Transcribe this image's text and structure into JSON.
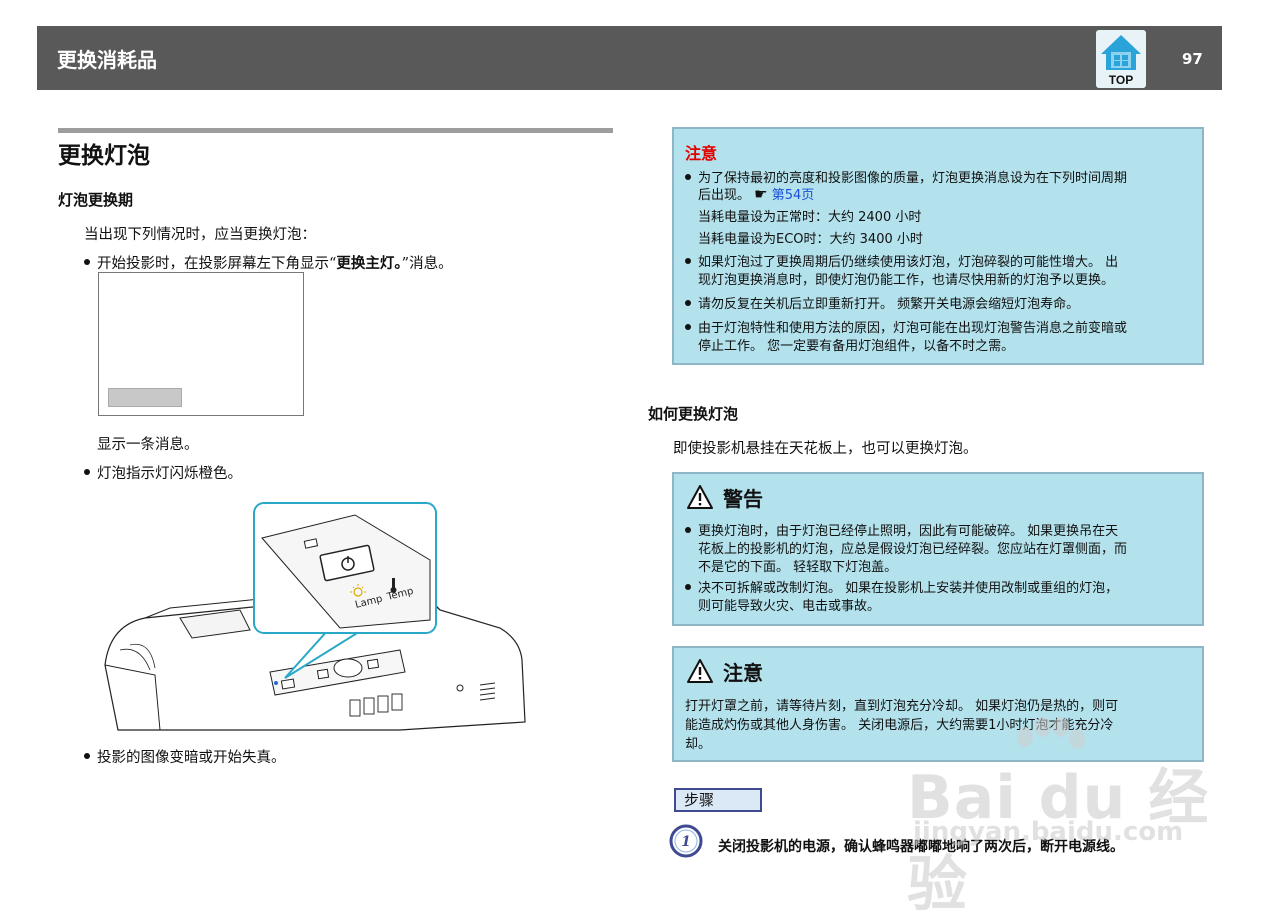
{
  "header": {
    "title": "更换消耗品",
    "top_label": "TOP",
    "page_number": "97",
    "top_icon": "top-house-icon",
    "colors": {
      "bar": "#595959",
      "top_icon": "#2aa4d8"
    }
  },
  "left": {
    "section_title": "更换灯泡",
    "subsection_title": "灯泡更换期",
    "intro": "当出现下列情况时，应当更换灯泡：",
    "bullet1_prefix": "开始投影时，在投影屏幕左下角显示“",
    "bullet1_bold": "更换主灯。",
    "bullet1_suffix": "”消息。",
    "screen_caption": "显示一条消息。",
    "bullet2": "灯泡指示灯闪烁橙色。",
    "bullet3": "投影的图像变暗或开始失真。",
    "figure": {
      "lamp_label": "Lamp",
      "temp_label": "Temp",
      "accent": "#2aa8c8"
    }
  },
  "caution_box": {
    "heading": "注意",
    "heading_color": "#e20000",
    "item1_line1": "为了保持最初的亮度和投影图像的质量，灯泡更换消息设为在下列时间周期",
    "item1_line2": "后出现。",
    "item1_hand_icon": "pointing-hand-icon",
    "item1_link": "第54页",
    "item1_normal": "当耗电量设为正常时：大约  2400  小时",
    "item1_eco": "当耗电量设为ECO时：大约  3400  小时",
    "item2_line1": "如果灯泡过了更换周期后仍继续使用该灯泡，灯泡碎裂的可能性增大。 出",
    "item2_line2": "现灯泡更换消息时，即使灯泡仍能工作，也请尽快用新的灯泡予以更换。",
    "item3_line1": "请勿反复在关机后立即重新打开。 频繁开关电源会缩短灯泡寿命。",
    "item4_line1": "由于灯泡特性和使用方法的原因，灯泡可能在出现灯泡警告消息之前变暗或",
    "item4_line2": "停止工作。 您一定要有备用灯泡组件，以备不时之需。",
    "box_color": "#b3e1ec"
  },
  "how": {
    "title": "如何更换灯泡",
    "text": "即使投影机悬挂在天花板上，也可以更换灯泡。"
  },
  "warning_box": {
    "heading": "警告",
    "icon": "warning-triangle-icon",
    "item1_line1": "更换灯泡时，由于灯泡已经停止照明，因此有可能破碎。 如果更换吊在天",
    "item1_line2": "花板上的投影机的灯泡，应总是假设灯泡已经碎裂。您应站在灯罩侧面，而",
    "item1_line3": "不是它的下面。 轻轻取下灯泡盖。",
    "item2_line1": "决不可拆解或改制灯泡。 如果在投影机上安装并使用改制或重组的灯泡，",
    "item2_line2": "则可能导致火灾、电击或事故。"
  },
  "caution2_box": {
    "heading": "注意",
    "icon": "warning-triangle-icon",
    "line1": "打开灯罩之前，请等待片刻，直到灯泡充分冷却。 如果灯泡仍是热的，则可",
    "line2": "能造成灼伤或其他人身伤害。 关闭电源后，大约需要1小时灯泡才能充分冷",
    "line3": "却。"
  },
  "steps": {
    "label": "步骤",
    "step1_number": "1",
    "step1_text": "关闭投影机的电源，确认蜂鸣器嘟嘟地响了两次后，断开电源线。"
  },
  "watermark": {
    "brand": "Bai du 经验",
    "url": "jingyan.baidu.com"
  }
}
